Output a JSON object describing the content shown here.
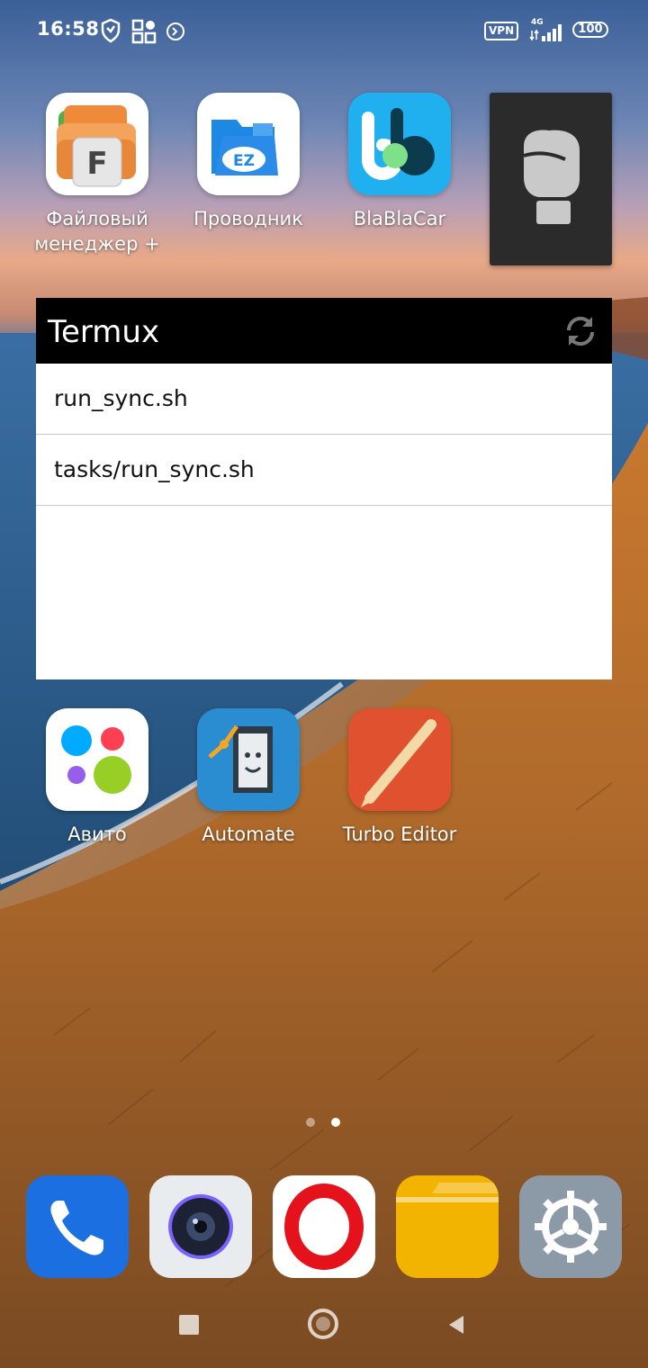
{
  "status_bar": {
    "time": "16:58",
    "left_icons": [
      "shield-icon",
      "qr-scanner-icon",
      "terminal-icon"
    ],
    "vpn_label": "VPN",
    "network_label": "4G",
    "battery_level": "100"
  },
  "home_top_row": [
    {
      "label": "Файловый менеджер +",
      "icon": "file-manager-plus-icon"
    },
    {
      "label": "Проводник",
      "icon": "ez-explorer-icon"
    },
    {
      "label": "BlaBlaCar",
      "icon": "blablacar-icon"
    }
  ],
  "boxing_widget": {
    "icon": "boxing-glove-icon"
  },
  "termux_widget": {
    "title": "Termux",
    "refresh_icon": "refresh-icon",
    "items": [
      "run_sync.sh",
      "tasks/run_sync.sh"
    ]
  },
  "home_mid_row": [
    {
      "label": "Авито",
      "icon": "avito-icon"
    },
    {
      "label": "Automate",
      "icon": "automate-icon"
    },
    {
      "label": "Turbo Editor",
      "icon": "turbo-editor-icon"
    }
  ],
  "page_indicator": {
    "pages": 2,
    "current": 2
  },
  "dock": [
    {
      "icon": "phone-icon"
    },
    {
      "icon": "camera-icon"
    },
    {
      "icon": "opera-icon"
    },
    {
      "icon": "notes-folder-icon"
    },
    {
      "icon": "settings-icon"
    }
  ],
  "nav_bar": [
    "recents-button",
    "home-button",
    "back-button"
  ],
  "colors": {
    "widget_header": "#000000",
    "dock_phone": "#1b6fe0",
    "dock_notes": "#f2b400",
    "turbo_editor": "#e0512f"
  }
}
